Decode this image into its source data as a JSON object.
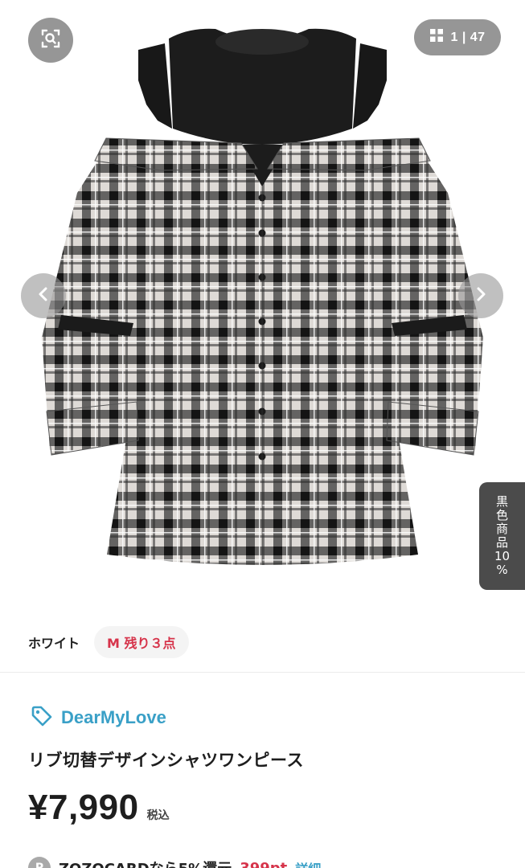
{
  "gallery": {
    "counter": "1 | 47",
    "product_image": "plaid-cold-shoulder-shirt-dress"
  },
  "side_tab": {
    "chars": [
      "黒",
      "色",
      "商",
      "品",
      "10",
      "%"
    ]
  },
  "variant": {
    "color": "ホワイト",
    "stock": "M 残り３点"
  },
  "product": {
    "brand": "DearMyLove",
    "title": "リブ切替デザインシャツワンピース",
    "price": "¥7,990",
    "tax_label": "税込"
  },
  "points": {
    "icon_letter": "P",
    "text": "ZOZOCARDなら5%還元",
    "amount": "399pt",
    "link": "詳細"
  },
  "colors": {
    "brand": "#3aa0c7",
    "accent_red": "#d6334a",
    "overlay": "#6e6e6e"
  },
  "icons": {
    "search": "image-search-icon",
    "grid": "grid-icon",
    "prev": "chevron-left-icon",
    "next": "chevron-right-icon",
    "brand": "tag-icon"
  }
}
